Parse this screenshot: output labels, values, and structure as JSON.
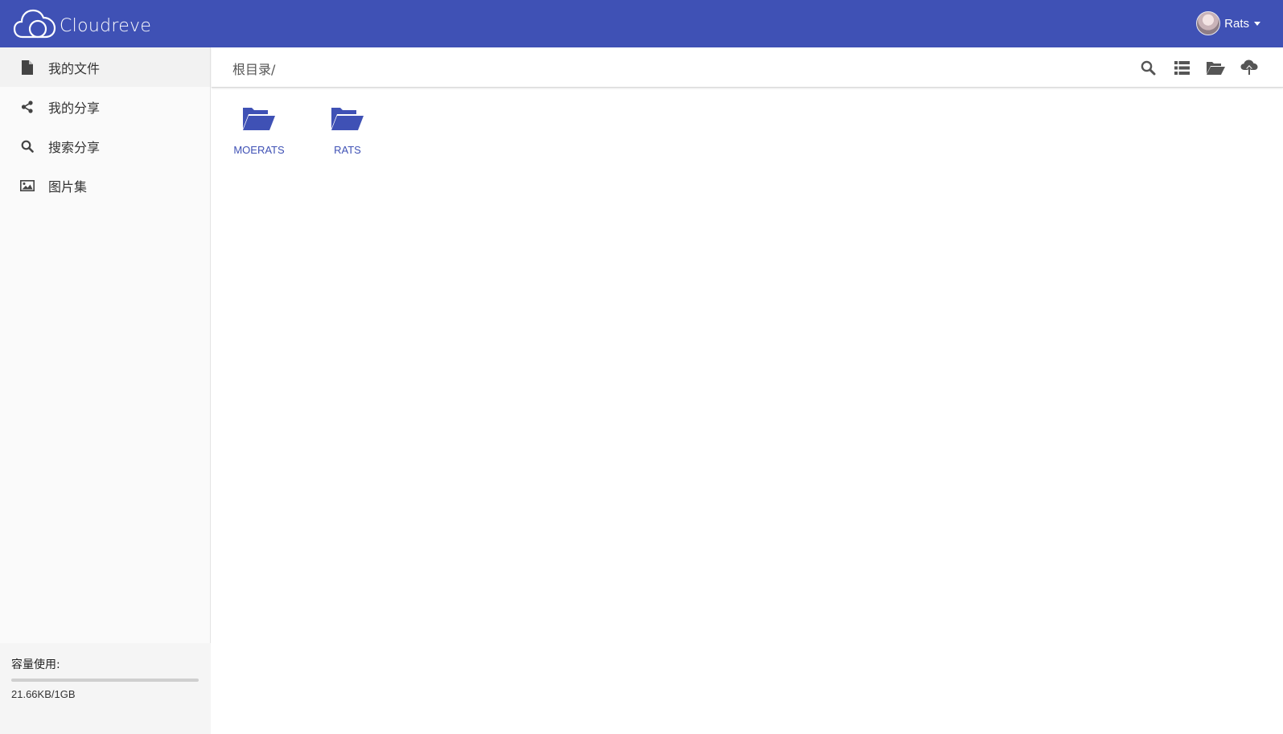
{
  "app": {
    "name": "Cloudreve"
  },
  "user": {
    "name": "Rats"
  },
  "sidebar": {
    "items": [
      {
        "label": "我的文件",
        "icon": "file-icon",
        "active": true
      },
      {
        "label": "我的分享",
        "icon": "share-icon",
        "active": false
      },
      {
        "label": "搜索分享",
        "icon": "search-icon",
        "active": false
      },
      {
        "label": "图片集",
        "icon": "image-icon",
        "active": false
      }
    ]
  },
  "storage": {
    "title": "容量使用:",
    "value": "21.66KB/1GB",
    "used_fraction": 2e-05
  },
  "breadcrumb": "根目录/",
  "toolbar": {
    "icons": [
      "search-icon",
      "list-view-icon",
      "new-folder-icon",
      "upload-icon"
    ]
  },
  "files": [
    {
      "name": "MOERATS",
      "type": "folder"
    },
    {
      "name": "RATS",
      "type": "folder"
    }
  ],
  "colors": {
    "primary": "#3f51b5",
    "sidebar_bg": "#fafafa",
    "icon_gray": "#555555"
  }
}
